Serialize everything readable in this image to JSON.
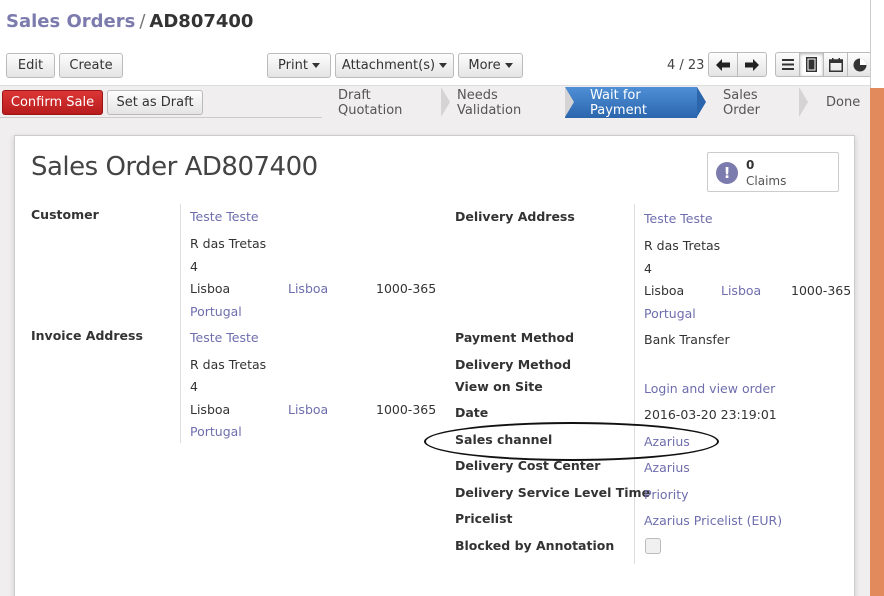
{
  "breadcrumb": {
    "parent": "Sales Orders",
    "separator": "/",
    "current": "AD807400"
  },
  "toolbar": {
    "edit_label": "Edit",
    "create_label": "Create",
    "print_label": "Print",
    "attachments_label": "Attachment(s)",
    "more_label": "More"
  },
  "pager": {
    "text": "4 / 23"
  },
  "statusbar": {
    "confirm_label": "Confirm Sale",
    "draft_label": "Set as Draft",
    "stages": [
      "Draft Quotation",
      "Needs Validation",
      "Wait for Payment",
      "Sales Order",
      "Done"
    ],
    "active_stage": "Wait for Payment"
  },
  "order": {
    "title_prefix": "Sales Order",
    "title_number": "AD807400"
  },
  "claims": {
    "count": "0",
    "label": "Claims"
  },
  "customer": {
    "label": "Customer",
    "name": "Teste Teste",
    "street": "R das Tretas",
    "number": "4",
    "city": "Lisboa",
    "state": "Lisboa",
    "zip": "1000-365",
    "country": "Portugal"
  },
  "invoice_address": {
    "label": "Invoice Address",
    "name": "Teste Teste",
    "street": "R das Tretas",
    "number": "4",
    "city": "Lisboa",
    "state": "Lisboa",
    "zip": "1000-365",
    "country": "Portugal"
  },
  "delivery_address": {
    "label": "Delivery Address",
    "name": "Teste Teste",
    "street": "R das Tretas",
    "number": "4",
    "city": "Lisboa",
    "state": "Lisboa",
    "zip": "1000-365",
    "country": "Portugal"
  },
  "fields": {
    "payment_method": {
      "label": "Payment Method",
      "value": "Bank Transfer"
    },
    "delivery_method": {
      "label": "Delivery Method",
      "value": ""
    },
    "view_on_site": {
      "label": "View on Site",
      "value": "Login and view order"
    },
    "date": {
      "label": "Date",
      "value": "2016-03-20 23:19:01"
    },
    "sales_channel": {
      "label": "Sales channel",
      "value": "Azarius"
    },
    "delivery_cost_center": {
      "label": "Delivery Cost Center",
      "value": "Azarius"
    },
    "delivery_service_level_time": {
      "label": "Delivery Service Level Time",
      "value": "Priority"
    },
    "pricelist": {
      "label": "Pricelist",
      "value": "Azarius Pricelist (EUR)"
    },
    "blocked_by_annotation": {
      "label": "Blocked by Annotation",
      "checked": false
    }
  },
  "icons": {
    "list_view": "list-icon",
    "form_view": "form-icon",
    "calendar_view": "calendar-icon",
    "graph_view": "pie-chart-icon",
    "prev": "arrow-left-icon",
    "next": "arrow-right-icon",
    "claims": "exclamation-icon"
  },
  "colors": {
    "accent": "#7c7bad",
    "primary_button": "#c62828",
    "active_stage": "#2b66ad"
  }
}
